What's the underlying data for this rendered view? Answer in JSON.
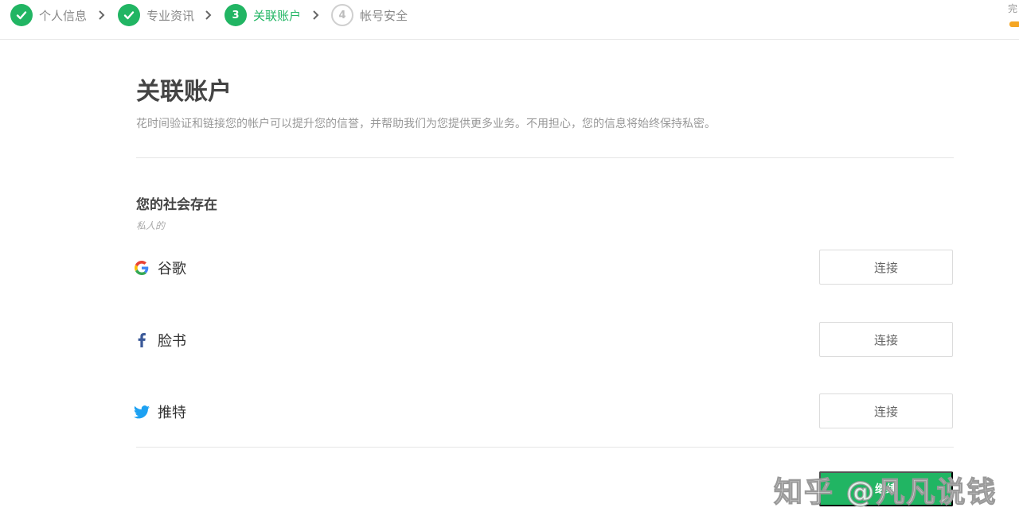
{
  "stepper": {
    "steps": [
      {
        "number": "",
        "label": "个人信息",
        "state": "done"
      },
      {
        "number": "",
        "label": "专业资讯",
        "state": "done"
      },
      {
        "number": "3",
        "label": "关联账户",
        "state": "active"
      },
      {
        "number": "4",
        "label": "帐号安全",
        "state": "todo"
      }
    ],
    "progress_text": "完",
    "progress_color": "#f5a623"
  },
  "main": {
    "title": "关联账户",
    "description": "花时间验证和链接您的帐户可以提升您的信誉，并帮助我们为您提供更多业务。不用担心，您的信息将始终保持私密。",
    "section_title": "您的社会存在",
    "section_subtitle": "私人的",
    "socials": [
      {
        "icon": "google-icon",
        "name": "谷歌",
        "button": "连接"
      },
      {
        "icon": "facebook-icon",
        "name": "脸书",
        "button": "连接"
      },
      {
        "icon": "twitter-icon",
        "name": "推特",
        "button": "连接"
      }
    ],
    "continue_label": "继续"
  },
  "watermark": "知乎 @凡凡说钱",
  "colors": {
    "accent": "#21b563",
    "facebook": "#3b5998",
    "twitter": "#1da1f2"
  }
}
